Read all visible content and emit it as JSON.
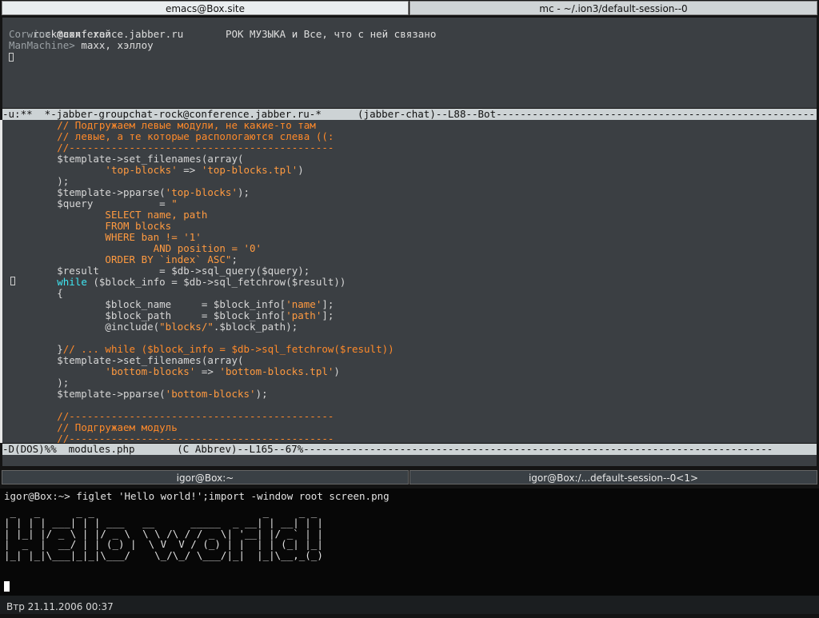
{
  "top_tabs": [
    "emacs@Box.site",
    "mc - ~/.ion3/default-session--0"
  ],
  "chat": {
    "header_room": "rock@conference.jabber.ru",
    "header_topic": "РОК МУЗЫКА и Все, что с ней связано",
    "messages": [
      {
        "nick": "Corwin>",
        "text": " maxx: хай"
      },
      {
        "nick": "ManMachine>",
        "text": " maxx, хэллоу"
      }
    ]
  },
  "modeline_chat": "-u:**  *-jabber-groupchat-rock@conference.jabber.ru-*      (jabber-chat)--L88--Bot-----------------------------------------------------",
  "code_lines": [
    [
      {
        "c": "",
        "t": "        "
      },
      {
        "c": "com",
        "t": "// Подгружаем левые модули, не какие-то там"
      }
    ],
    [
      {
        "c": "",
        "t": "        "
      },
      {
        "c": "com",
        "t": "// левые, а те которые распологаются слева ((:"
      }
    ],
    [
      {
        "c": "",
        "t": "        "
      },
      {
        "c": "com",
        "t": "//--------------------------------------------"
      }
    ],
    [
      {
        "c": "",
        "t": "        $template->set_filenames(array("
      }
    ],
    [
      {
        "c": "",
        "t": "                "
      },
      {
        "c": "str",
        "t": "'top-blocks'"
      },
      {
        "c": "",
        "t": " => "
      },
      {
        "c": "str",
        "t": "'top-blocks.tpl'"
      },
      {
        "c": "",
        "t": ")"
      }
    ],
    [
      {
        "c": "",
        "t": "        );"
      }
    ],
    [
      {
        "c": "",
        "t": "        $template->pparse("
      },
      {
        "c": "str",
        "t": "'top-blocks'"
      },
      {
        "c": "",
        "t": ");"
      }
    ],
    [
      {
        "c": "",
        "t": "        $query           = "
      },
      {
        "c": "str",
        "t": "\""
      }
    ],
    [
      {
        "c": "",
        "t": "                "
      },
      {
        "c": "str",
        "t": "SELECT name, path"
      }
    ],
    [
      {
        "c": "",
        "t": "                "
      },
      {
        "c": "str",
        "t": "FROM blocks"
      }
    ],
    [
      {
        "c": "",
        "t": "                "
      },
      {
        "c": "str",
        "t": "WHERE ban != '1'"
      }
    ],
    [
      {
        "c": "",
        "t": "                        "
      },
      {
        "c": "str",
        "t": "AND position = '0'"
      }
    ],
    [
      {
        "c": "",
        "t": "                "
      },
      {
        "c": "str",
        "t": "ORDER BY `index` ASC\""
      },
      {
        "c": "",
        "t": ";"
      }
    ],
    [
      {
        "c": "",
        "t": "        $result          = $db->sql_query($query);"
      }
    ],
    [
      {
        "c": "",
        "t": "        "
      },
      {
        "c": "kw",
        "t": "while"
      },
      {
        "c": "",
        "t": " ($block_info = $db->sql_fetchrow($result))"
      }
    ],
    [
      {
        "c": "",
        "t": "        {"
      }
    ],
    [
      {
        "c": "",
        "t": "                $block_name     = $block_info["
      },
      {
        "c": "str",
        "t": "'name'"
      },
      {
        "c": "",
        "t": "];"
      }
    ],
    [
      {
        "c": "",
        "t": "                $block_path     = $block_info["
      },
      {
        "c": "str",
        "t": "'path'"
      },
      {
        "c": "",
        "t": "];"
      }
    ],
    [
      {
        "c": "",
        "t": "                @include("
      },
      {
        "c": "str",
        "t": "\"blocks/\""
      },
      {
        "c": "",
        "t": ".$block_path);"
      }
    ],
    [
      {
        "c": "",
        "t": ""
      }
    ],
    [
      {
        "c": "",
        "t": "        }"
      },
      {
        "c": "com",
        "t": "// ... while ($block_info = $db->sql_fetchrow($result))"
      }
    ],
    [
      {
        "c": "",
        "t": "        $template->set_filenames(array("
      }
    ],
    [
      {
        "c": "",
        "t": "                "
      },
      {
        "c": "str",
        "t": "'bottom-blocks'"
      },
      {
        "c": "",
        "t": " => "
      },
      {
        "c": "str",
        "t": "'bottom-blocks.tpl'"
      },
      {
        "c": "",
        "t": ")"
      }
    ],
    [
      {
        "c": "",
        "t": "        );"
      }
    ],
    [
      {
        "c": "",
        "t": "        $template->pparse("
      },
      {
        "c": "str",
        "t": "'bottom-blocks'"
      },
      {
        "c": "",
        "t": ");"
      }
    ],
    [
      {
        "c": "",
        "t": ""
      }
    ],
    [
      {
        "c": "",
        "t": "        "
      },
      {
        "c": "com",
        "t": "//--------------------------------------------"
      }
    ],
    [
      {
        "c": "",
        "t": "        "
      },
      {
        "c": "com",
        "t": "// Подгружаем модуль"
      }
    ],
    [
      {
        "c": "",
        "t": "        "
      },
      {
        "c": "com",
        "t": "//--------------------------------------------"
      }
    ]
  ],
  "modeline_code": "-D(DOS)%%  modules.php       (C Abbrev)--L165--67%------------------------------------------------------------------------------",
  "bottom_tabs": [
    "igor@Box:~",
    "igor@Box:/...default-session--0<1>"
  ],
  "terminal_lines": [
    "igor@Box:~> figlet 'Hello world!';import -window root screen.png",
    " _   _      _ _                            _     _ _ ",
    "| | | | ___| | | ___   __      _____  _ __| | __| | |",
    "| |_| |/ _ \\ | |/ _ \\  \\ \\ /\\ / / _ \\| '__| |/ _` | |",
    "|  _  |  __/ | | (_) |  \\ V  V / (_) | |  | | (_| |_|",
    "|_| |_|\\___|_|_|\\___/    \\_/\\_/ \\___/|_|  |_|\\__,_(_)"
  ],
  "status_clock": "Втр 21.11.2006 00:37"
}
